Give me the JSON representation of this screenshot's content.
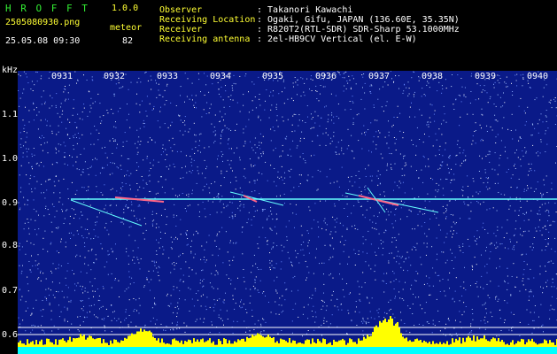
{
  "header": {
    "app_name": "H R O F F T",
    "version": "1.0.0",
    "filename": "2505080930.png",
    "datetime": "25.05.08 09:30",
    "meteor_label": "meteor",
    "meteor_count": "82",
    "fields": [
      {
        "label": "Observer",
        "value": ": Takanori Kawachi"
      },
      {
        "label": "Receiving Location",
        "value": ": Ogaki, Gifu, JAPAN (136.60E, 35.35N)"
      },
      {
        "label": "Receiver",
        "value": ": R820T2(RTL-SDR) SDR-Sharp 53.1000MHz"
      },
      {
        "label": "Receiving antenna",
        "value": ": 2el-HB9CV Vertical (el. E-W)"
      }
    ]
  },
  "plot": {
    "y_unit": "kHz",
    "x_ticks": [
      "0931",
      "0932",
      "0933",
      "0934",
      "0935",
      "0936",
      "0937",
      "0938",
      "0939",
      "0940"
    ],
    "y_ticks": [
      "1.1",
      "1.0",
      "0.9",
      "0.8",
      "0.7",
      "0.6"
    ],
    "colors": {
      "background": "#0a1a88",
      "signal_line": "#66ffff",
      "bars": "#ffff00",
      "base": "#00ffff"
    }
  }
}
